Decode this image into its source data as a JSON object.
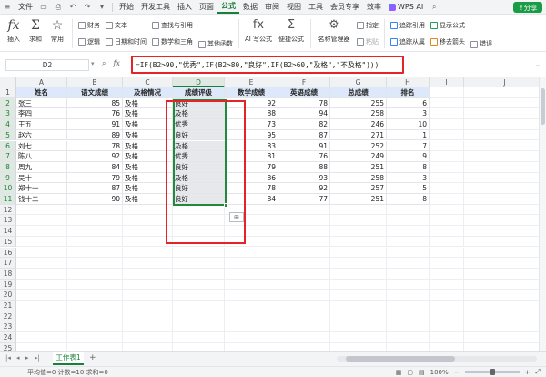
{
  "menubar": {
    "items": [
      "文件",
      "开始",
      "开发工具",
      "插入",
      "页面",
      "公式",
      "数据",
      "审阅",
      "视图",
      "工具",
      "会员专享",
      "效率"
    ],
    "active_index": 5,
    "wps_ai": "WPS AI",
    "share": "分享"
  },
  "ribbon": {
    "insert_fn": "插入",
    "sum": "求和",
    "common": "常用",
    "finance": "财务",
    "logic": "逻辑",
    "text": "文本",
    "datetime": "日期和时间",
    "lookup": "查找与引用",
    "math": "数学和三角",
    "other_fn": "其他函数",
    "ai_formula": "AI 写公式",
    "easy_formula": "便捷公式",
    "name_manager": "名称管理器",
    "specify": "指定",
    "paste": "粘贴",
    "trace_precedents": "追踪引用",
    "trace_dependents": "追踪从属",
    "show_formula": "显示公式",
    "remove_arrows": "移去箭头",
    "error_check": "错误"
  },
  "formula_bar": {
    "name_box": "D2",
    "formula": "=IF(B2>90,\"优秀\",IF(B2>80,\"良好\",IF(B2>60,\"及格\",\"不及格\")))"
  },
  "columns": [
    "A",
    "B",
    "C",
    "D",
    "E",
    "F",
    "G",
    "H",
    "I",
    "J"
  ],
  "selected_column": "D",
  "headers": [
    "姓名",
    "语文成绩",
    "及格情况",
    "成绩评级",
    "数学成绩",
    "英语成绩",
    "总成绩",
    "排名"
  ],
  "rows": [
    {
      "name": "张三",
      "chinese": "85",
      "pass": "及格",
      "grade": "良好",
      "math": "92",
      "english": "78",
      "total": "255",
      "rank": "6"
    },
    {
      "name": "李四",
      "chinese": "76",
      "pass": "及格",
      "grade": "及格",
      "math": "88",
      "english": "94",
      "total": "258",
      "rank": "3"
    },
    {
      "name": "王五",
      "chinese": "91",
      "pass": "及格",
      "grade": "优秀",
      "math": "73",
      "english": "82",
      "total": "246",
      "rank": "10"
    },
    {
      "name": "赵六",
      "chinese": "89",
      "pass": "及格",
      "grade": "良好",
      "math": "95",
      "english": "87",
      "total": "271",
      "rank": "1"
    },
    {
      "name": "刘七",
      "chinese": "78",
      "pass": "及格",
      "grade": "及格",
      "math": "83",
      "english": "91",
      "total": "252",
      "rank": "7"
    },
    {
      "name": "陈八",
      "chinese": "92",
      "pass": "及格",
      "grade": "优秀",
      "math": "81",
      "english": "76",
      "total": "249",
      "rank": "9"
    },
    {
      "name": "周九",
      "chinese": "84",
      "pass": "及格",
      "grade": "良好",
      "math": "79",
      "english": "88",
      "total": "251",
      "rank": "8"
    },
    {
      "name": "吴十",
      "chinese": "79",
      "pass": "及格",
      "grade": "及格",
      "math": "86",
      "english": "93",
      "total": "258",
      "rank": "3"
    },
    {
      "name": "郑十一",
      "chinese": "87",
      "pass": "及格",
      "grade": "良好",
      "math": "78",
      "english": "92",
      "total": "257",
      "rank": "5"
    },
    {
      "name": "钱十二",
      "chinese": "90",
      "pass": "及格",
      "grade": "良好",
      "math": "84",
      "english": "77",
      "total": "251",
      "rank": "8"
    }
  ],
  "row_numbers": [
    "1",
    "2",
    "3",
    "4",
    "5",
    "6",
    "7",
    "8",
    "9",
    "10",
    "11",
    "12",
    "13",
    "14",
    "15",
    "16",
    "17",
    "18",
    "19",
    "20",
    "21",
    "22",
    "23",
    "24",
    "25"
  ],
  "sheet_tab": "工作表1",
  "status": {
    "summary": "平均值=0  计数=10  求和=0",
    "zoom": "100%"
  },
  "colors": {
    "accent": "#1a7f3c",
    "header_fill": "#dde9fb",
    "highlight_red": "#e5242a",
    "selection_green": "#22893f"
  }
}
